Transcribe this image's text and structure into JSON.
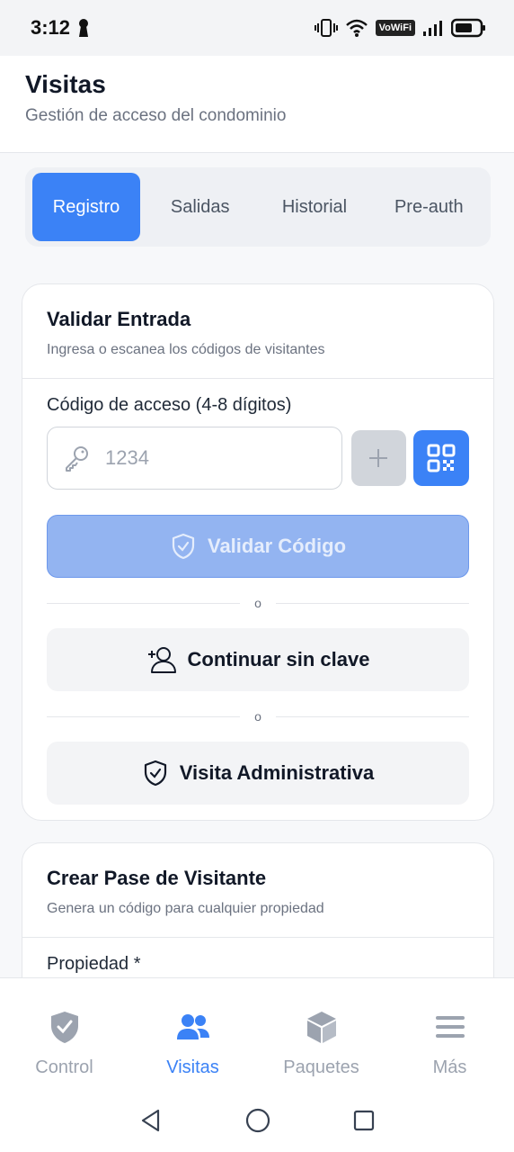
{
  "status_bar": {
    "time": "3:12",
    "network_label": "VoWiFi"
  },
  "header": {
    "title": "Visitas",
    "subtitle": "Gestión de acceso del condominio"
  },
  "tabs": [
    {
      "label": "Registro",
      "active": true
    },
    {
      "label": "Salidas",
      "active": false
    },
    {
      "label": "Historial",
      "active": false
    },
    {
      "label": "Pre-auth",
      "active": false
    }
  ],
  "validate_card": {
    "title": "Validar Entrada",
    "subtitle": "Ingresa o escanea los códigos de visitantes",
    "code_label": "Código de acceso (4-8 dígitos)",
    "code_placeholder": "1234",
    "code_value": "",
    "validate_label": "Validar Código",
    "divider_text": "o",
    "continue_label": "Continuar sin clave",
    "admin_label": "Visita Administrativa"
  },
  "pass_card": {
    "title": "Crear Pase de Visitante",
    "subtitle": "Genera un código para cualquier propiedad",
    "property_label": "Propiedad *"
  },
  "bottom_nav": [
    {
      "label": "Control",
      "icon": "shield-check-icon",
      "active": false
    },
    {
      "label": "Visitas",
      "icon": "users-icon",
      "active": true
    },
    {
      "label": "Paquetes",
      "icon": "package-icon",
      "active": false
    },
    {
      "label": "Más",
      "icon": "menu-icon",
      "active": false
    }
  ],
  "colors": {
    "accent": "#3b82f6",
    "accent_disabled": "#93b4f1",
    "muted": "#9ca3af"
  }
}
